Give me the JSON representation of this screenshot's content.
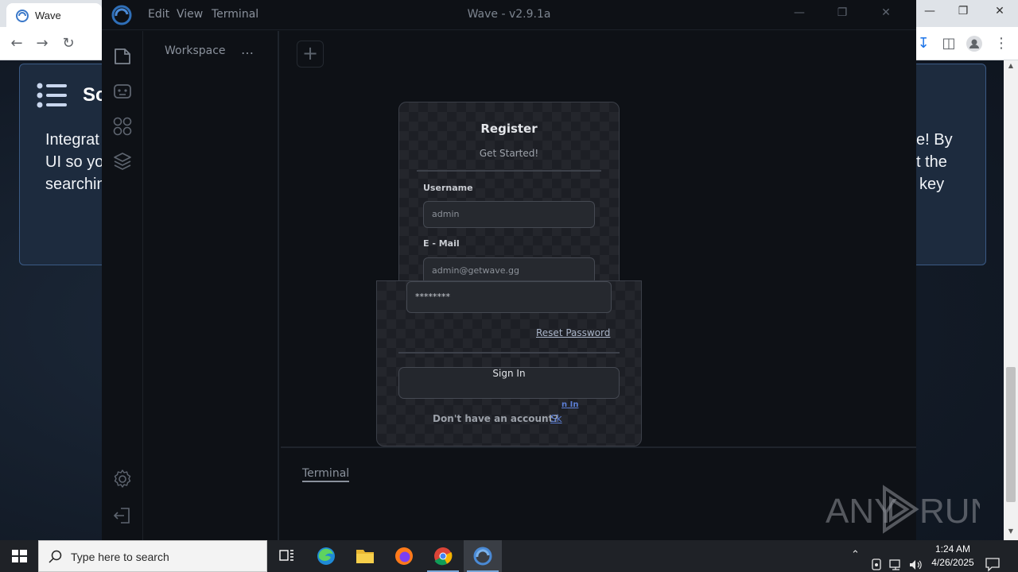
{
  "browser": {
    "tab_title": "Wave",
    "page_card": {
      "heading": "Sc",
      "left_lines": [
        "Integrat",
        "UI so yo",
        "searchin"
      ],
      "right_lines": [
        "e! By",
        "t the",
        "key"
      ]
    }
  },
  "wave_app": {
    "title": "Wave - v2.9.1a",
    "menu": [
      "Edit",
      "View",
      "Terminal"
    ],
    "sidebar_icons": [
      "files-icon",
      "robot-icon",
      "apps-grid-icon",
      "layers-icon",
      "settings-icon",
      "logout-icon"
    ],
    "workspace_label": "Workspace",
    "workspace_more": "…",
    "add_tab_symbol": "+",
    "terminal_tab": "Terminal"
  },
  "register_dialog": {
    "title": "Register",
    "subtitle": "Get Started!",
    "username_label": "Username",
    "username_placeholder": "admin",
    "email_label": "E - Mail",
    "email_placeholder": "admin@getwave.gg",
    "password_value": "********",
    "reset_password": "Reset Password",
    "sign_in_button": "Sign In",
    "ghost_link": "n In",
    "no_account_text": "Don't have an account?",
    "signup_link_partial": "Sk"
  },
  "watermark": "ANY RUN",
  "taskbar": {
    "search_placeholder": "Type here to search",
    "time": "1:24 AM",
    "date": "4/26/2025"
  },
  "colors": {
    "wave_bg": "#0e1116",
    "dialog_bg": "#1d1f25",
    "link_blue": "#5c7fd6",
    "taskbar_bg": "#1f2227"
  }
}
